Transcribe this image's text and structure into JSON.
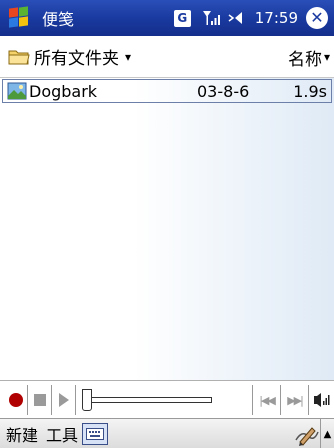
{
  "title_bar": {
    "app_title": "便笺",
    "network_label": "G",
    "clock": "17:59",
    "close_glyph": "✕"
  },
  "folder_bar": {
    "folder_label": "所有文件夹",
    "folder_caret": "▾",
    "sort_label": "名称",
    "sort_caret": "▾"
  },
  "list": {
    "items": [
      {
        "name": "Dogbark",
        "date": "03-8-6",
        "duration": "1.9s"
      }
    ]
  },
  "player": {
    "position_fraction": 0.0,
    "prev_glyph": "|◀◀",
    "next_glyph": "▶▶|"
  },
  "menu_bar": {
    "new_label": "新建",
    "tools_label": "工具",
    "up_arrow": "▲"
  },
  "colors": {
    "title_bar": "#1a3aa0",
    "record": "#b00000",
    "selection_border": "#6b7fa8"
  },
  "icons": {
    "start": "windows-flag-icon",
    "network": "g-network-icon",
    "signal": "signal-strength-icon",
    "volume": "volume-icon",
    "close": "close-icon",
    "folder": "folder-icon",
    "file": "image-file-icon",
    "record": "record-icon",
    "stop": "stop-icon",
    "play": "play-icon",
    "prev": "previous-icon",
    "next": "next-icon",
    "vol_bar": "volume-bars-icon",
    "keyboard": "keyboard-icon",
    "pen": "pen-input-icon"
  }
}
